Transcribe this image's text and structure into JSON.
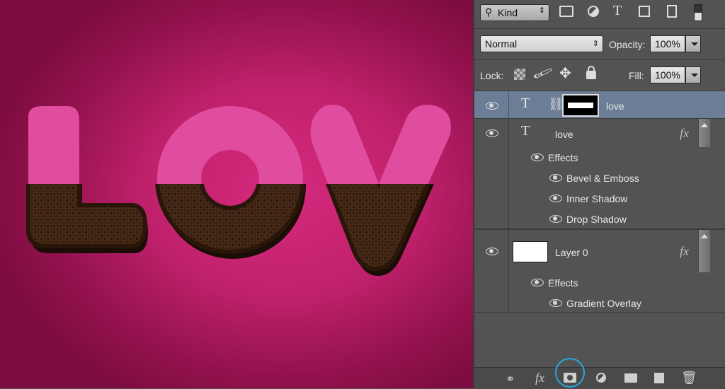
{
  "canvas": {
    "text": "LOV"
  },
  "filter_bar": {
    "kind_label": "Kind"
  },
  "blend": {
    "mode": "Normal",
    "opacity_label": "Opacity:",
    "opacity_value": "100%"
  },
  "lock_bar": {
    "lock_label": "Lock:",
    "fill_label": "Fill:",
    "fill_value": "100%"
  },
  "layers": {
    "mask_layer": {
      "name": "love"
    },
    "text_layer": {
      "name": "love",
      "fx": "fx",
      "effects_label": "Effects",
      "effects": [
        "Bevel & Emboss",
        "Inner Shadow",
        "Drop Shadow"
      ]
    },
    "layer0": {
      "name": "Layer 0",
      "fx": "fx",
      "effects_label": "Effects",
      "effects": [
        "Gradient Overlay"
      ]
    }
  },
  "bottom_icons": [
    "link-icon",
    "fx-icon",
    "add-mask-icon",
    "adjustment-icon",
    "folder-icon",
    "new-layer-icon",
    "trash-icon"
  ],
  "bottom_fx": "fx",
  "colors": {
    "canvas_pink": "#c9246f",
    "letter_pink": "#e04c9e",
    "chocolate": "#3b2212",
    "selection": "#6b7e96",
    "highlight_circle": "#2aa6e0"
  }
}
